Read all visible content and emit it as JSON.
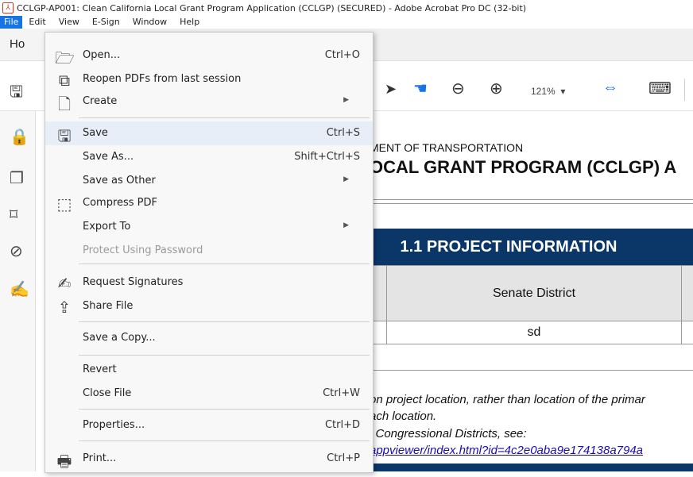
{
  "window": {
    "title": "CCLGP-AP001: Clean California Local Grant Program Application (CCLGP) (SECURED) - Adobe Acrobat Pro DC (32-bit)"
  },
  "menubar": [
    "File",
    "Edit",
    "View",
    "E-Sign",
    "Window",
    "Help"
  ],
  "tabs": {
    "home": "Ho"
  },
  "toolbar": {
    "zoom": "121%"
  },
  "file_menu": {
    "items": [
      {
        "label": "Open...",
        "shortcut": "Ctrl+O",
        "icon": "folder-open-icon"
      },
      {
        "label": "Reopen PDFs from last session",
        "shortcut": "",
        "icon": "reopen-icon"
      },
      {
        "label": "Create",
        "shortcut": "",
        "icon": "create-pdf-icon",
        "submenu": true
      },
      {
        "label": "Save",
        "shortcut": "Ctrl+S",
        "icon": "save-icon",
        "highlighted": true
      },
      {
        "label": "Save As...",
        "shortcut": "Shift+Ctrl+S"
      },
      {
        "label": "Save as Other",
        "shortcut": "",
        "submenu": true
      },
      {
        "label": "Compress PDF",
        "shortcut": "",
        "icon": "compress-icon"
      },
      {
        "label": "Export To",
        "shortcut": "",
        "submenu": true
      },
      {
        "label": "Protect Using Password",
        "shortcut": "",
        "disabled": true
      },
      {
        "label": "Request Signatures",
        "shortcut": "",
        "icon": "sign-icon"
      },
      {
        "label": "Share File",
        "shortcut": "",
        "icon": "share-icon"
      },
      {
        "label": "Save a Copy...",
        "shortcut": ""
      },
      {
        "label": "Revert",
        "shortcut": ""
      },
      {
        "label": "Close File",
        "shortcut": "Ctrl+W"
      },
      {
        "label": "Properties...",
        "shortcut": "Ctrl+D"
      },
      {
        "label": "Print...",
        "shortcut": "Ctrl+P",
        "icon": "printer-icon"
      }
    ]
  },
  "document": {
    "dept_line": "MENT OF TRANSPORTATION",
    "title_line": "OCAL GRANT PROGRAM (CCLGP) A",
    "section_header": "1.1 PROJECT INFORMATION",
    "column_header": "Senate District",
    "column_value": "sd",
    "note_line1": "on project location, rather than location of the primar",
    "note_line2": "ach location.",
    "note_line3": "l Congressional Districts, see:",
    "link_text": "appviewer/index.html?id=4c2e0aba9e174138a794a"
  }
}
